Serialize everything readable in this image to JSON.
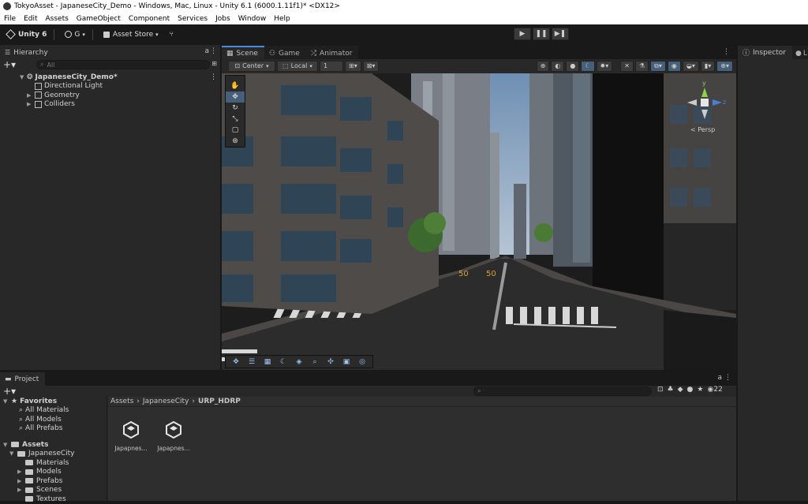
{
  "window": {
    "title": "TokyoAsset - JapaneseCity_Demo - Windows, Mac, Linux - Unity 6.1 (6000.1.11f1)* <DX12>"
  },
  "menu": [
    "File",
    "Edit",
    "Assets",
    "GameObject",
    "Component",
    "Services",
    "Jobs",
    "Window",
    "Help"
  ],
  "toolbar": {
    "unity_label": "Unity 6",
    "account_label": "G",
    "asset_store_label": "Asset Store",
    "play_icon": "play-icon",
    "pause_icon": "pause-icon",
    "step_icon": "step-icon"
  },
  "hierarchy": {
    "tab_label": "Hierarchy",
    "search_placeholder": "All",
    "scene_name": "JapaneseCity_Demo*",
    "items": [
      {
        "label": "Directional Light",
        "expandable": false
      },
      {
        "label": "Geometry",
        "expandable": true
      },
      {
        "label": "Colliders",
        "expandable": true
      }
    ]
  },
  "scene_tabs": [
    {
      "label": "Scene",
      "active": true
    },
    {
      "label": "Game",
      "active": false
    },
    {
      "label": "Animator",
      "active": false
    }
  ],
  "scene_toolbar": {
    "pivot_label": "Center",
    "space_label": "Local",
    "grid_value": "1"
  },
  "gizmo": {
    "projection_label": "< Persp",
    "y_label": "y",
    "z_label": "z"
  },
  "scene_labels": {
    "road_marking_1": "50",
    "road_marking_2": "50"
  },
  "inspector": {
    "tab_label": "Inspector",
    "second_tab": "L"
  },
  "project": {
    "tab_label": "Project",
    "favorites_label": "Favorites",
    "favorites": [
      "All Materials",
      "All Models",
      "All Prefabs"
    ],
    "assets_label": "Assets",
    "tree": [
      {
        "label": "JapaneseCity",
        "depth": 1,
        "expandable": true
      },
      {
        "label": "Materials",
        "depth": 2,
        "expandable": false
      },
      {
        "label": "Models",
        "depth": 2,
        "expandable": true
      },
      {
        "label": "Prefabs",
        "depth": 2,
        "expandable": true
      },
      {
        "label": "Scenes",
        "depth": 2,
        "expandable": true
      },
      {
        "label": "Textures",
        "depth": 2,
        "expandable": false
      }
    ],
    "breadcrumb": [
      "Assets",
      "JapaneseCity",
      "URP_HDRP"
    ],
    "files": [
      "Japapnes...",
      "Japapnes..."
    ],
    "visible_count": "22"
  },
  "colors": {
    "accent": "#4a8be0",
    "panel": "#282828",
    "background": "#191919",
    "selected_tool": "#46607c"
  }
}
